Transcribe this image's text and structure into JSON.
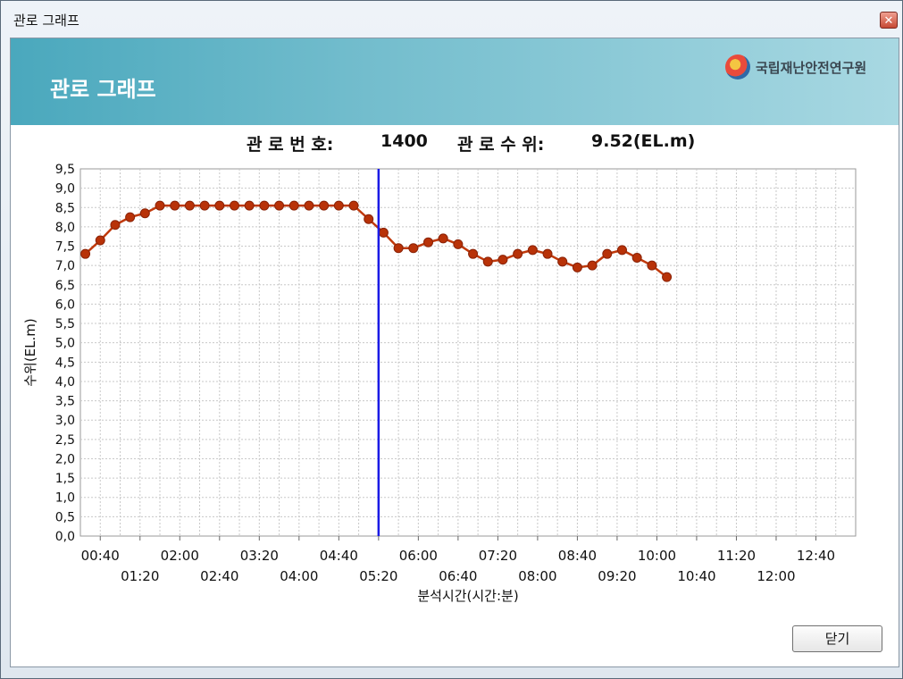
{
  "window": {
    "title": "관로 그래프",
    "close_icon": "close-icon"
  },
  "banner": {
    "title": "관로 그래프",
    "logo_text": "국립재난안전연구원"
  },
  "info": {
    "pipe_label": "관 로 번 호:",
    "pipe_number": "1400",
    "level_label": "관 로 수 위:",
    "level_value": "9.52(EL.m)"
  },
  "footer": {
    "close_label": "닫기"
  },
  "colors": {
    "series": "#c0390b",
    "marker": "#b83208",
    "vline": "#1a1ae6",
    "grid": "#c8c8c8"
  },
  "chart_data": {
    "type": "line",
    "xlabel": "분석시간(시간:분)",
    "ylabel": "수위(EL.m)",
    "ylim": [
      0,
      9.5
    ],
    "ytick_step": 0.5,
    "yticks": [
      "0,0",
      "0,5",
      "1,0",
      "1,5",
      "2,0",
      "2,5",
      "3,0",
      "3,5",
      "4,0",
      "4,5",
      "5,0",
      "5,5",
      "6,0",
      "6,5",
      "7,0",
      "7,5",
      "8,0",
      "8,5",
      "9,0",
      "9,5"
    ],
    "xlim_minutes": [
      20,
      800
    ],
    "xticks": [
      "00:40",
      "01:20",
      "02:00",
      "02:40",
      "03:20",
      "04:00",
      "04:40",
      "05:20",
      "06:00",
      "06:40",
      "07:20",
      "08:00",
      "08:40",
      "09:20",
      "10:00",
      "10:40",
      "11:20",
      "12:00",
      "12:40"
    ],
    "grid": true,
    "vertical_marker": "05:20",
    "series": [
      {
        "x": [
          "00:25",
          "00:40",
          "00:55",
          "01:10",
          "01:25",
          "01:40",
          "01:55",
          "02:10",
          "02:25",
          "02:40",
          "02:55",
          "03:10",
          "03:25",
          "03:40",
          "03:55",
          "04:10",
          "04:25",
          "04:40",
          "04:55",
          "05:10",
          "05:25",
          "05:40",
          "05:55",
          "06:10",
          "06:25",
          "06:40",
          "06:55",
          "07:10",
          "07:25",
          "07:40",
          "07:55",
          "08:10",
          "08:25",
          "08:40",
          "08:55",
          "09:10",
          "09:25",
          "09:40",
          "09:55",
          "10:10"
        ],
        "y": [
          7.3,
          7.65,
          8.05,
          8.25,
          8.35,
          8.55,
          8.55,
          8.55,
          8.55,
          8.55,
          8.55,
          8.55,
          8.55,
          8.55,
          8.55,
          8.55,
          8.55,
          8.55,
          8.55,
          8.2,
          7.85,
          7.45,
          7.45,
          7.6,
          7.7,
          7.55,
          7.3,
          7.1,
          7.15,
          7.3,
          7.4,
          7.3,
          7.1,
          6.95,
          7.0,
          7.3,
          7.4,
          7.2,
          7.0,
          6.7
        ]
      }
    ]
  }
}
